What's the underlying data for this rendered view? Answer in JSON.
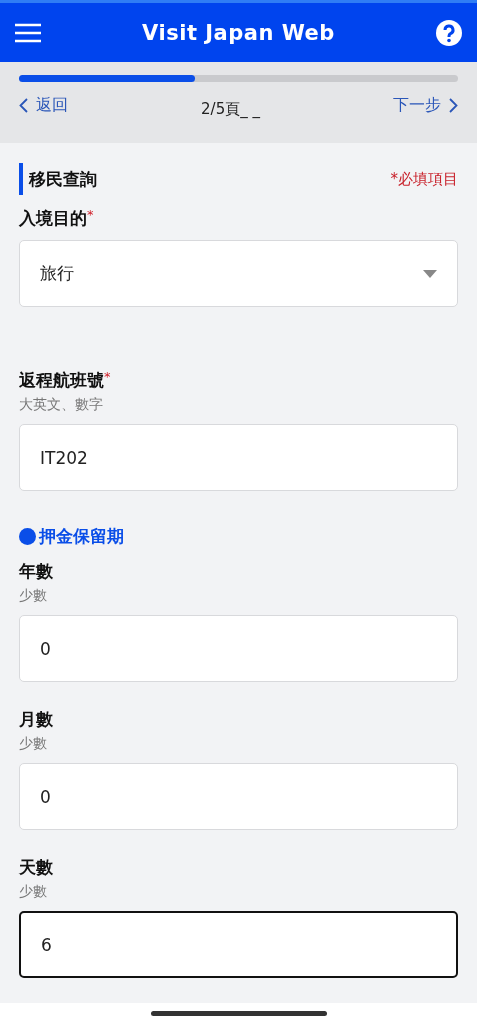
{
  "header": {
    "title": "Visit Japan Web"
  },
  "progress": {
    "level": 0.4
  },
  "nav": {
    "back": "返回",
    "page": "2/5頁_ _",
    "next": "下一步"
  },
  "section": {
    "title": "移民查詢",
    "required_note": "*必填項目"
  },
  "fields": [
    {
      "kind": "select",
      "label": "入境目的",
      "required_mark": "*",
      "value": "旅行",
      "focused": false
    },
    {
      "kind": "input",
      "label": "返程航班號",
      "required_mark": "*",
      "hint": "大英文、數字",
      "value": "IT202",
      "focused": false
    },
    {
      "kind": "heading",
      "label": "押金保留期"
    },
    {
      "kind": "input",
      "label": "年數",
      "hint": "少數",
      "value": "0",
      "focused": false
    },
    {
      "kind": "input",
      "label": "月數",
      "hint": "少數",
      "value": "0",
      "focused": false
    },
    {
      "kind": "input",
      "label": "天數",
      "hint": "少數",
      "value": "6",
      "focused": true
    }
  ]
}
